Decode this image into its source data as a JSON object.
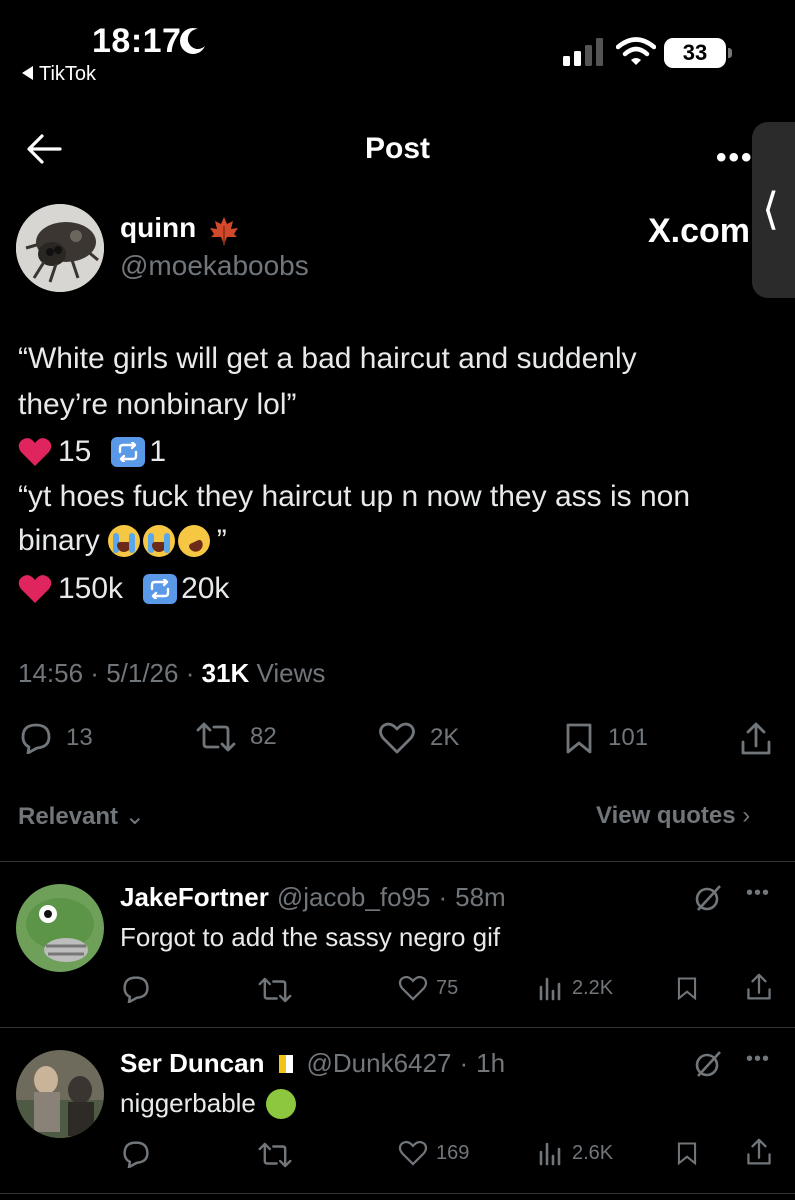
{
  "status_bar": {
    "time": "18:17",
    "back_app": "TikTok",
    "battery": "33"
  },
  "header": {
    "title": "Post"
  },
  "post": {
    "author_name": "quinn",
    "author_handle": "@moekaboobs",
    "watermark": "X.com",
    "line1": "“White girls will get a bad haircut and suddenly",
    "line2": "they’re nonbinary lol”",
    "quote1_likes": "15",
    "quote1_reposts": "1",
    "line3": "“yt hoes fuck they haircut up n now they ass is non",
    "line4": "binary",
    "line4_end": "”",
    "quote2_likes": "150k",
    "quote2_reposts": "20k",
    "time": "14:56",
    "date": "5/1/26",
    "views_count": "31K",
    "views_label": "Views",
    "replies": "13",
    "reposts": "82",
    "likes": "2K",
    "bookmarks": "101"
  },
  "sort": {
    "label": "Relevant",
    "view_quotes": "View quotes"
  },
  "replies": [
    {
      "name": "JakeFortner",
      "handle": "@jacob_fo95",
      "time": "58m",
      "text": "Forgot to add the sassy negro gif",
      "likes": "75",
      "views": "2.2K"
    },
    {
      "name": "Ser Duncan",
      "handle": "@Dunk6427",
      "time": "1h",
      "text": "niggerbable",
      "likes": "169",
      "views": "2.6K"
    }
  ],
  "colors": {
    "background": "#000000",
    "text": "#e7e9ea",
    "muted": "#71767b",
    "divider": "#2f3336",
    "heart_red": "#e0245e",
    "repost_blue": "#5a98e8"
  }
}
